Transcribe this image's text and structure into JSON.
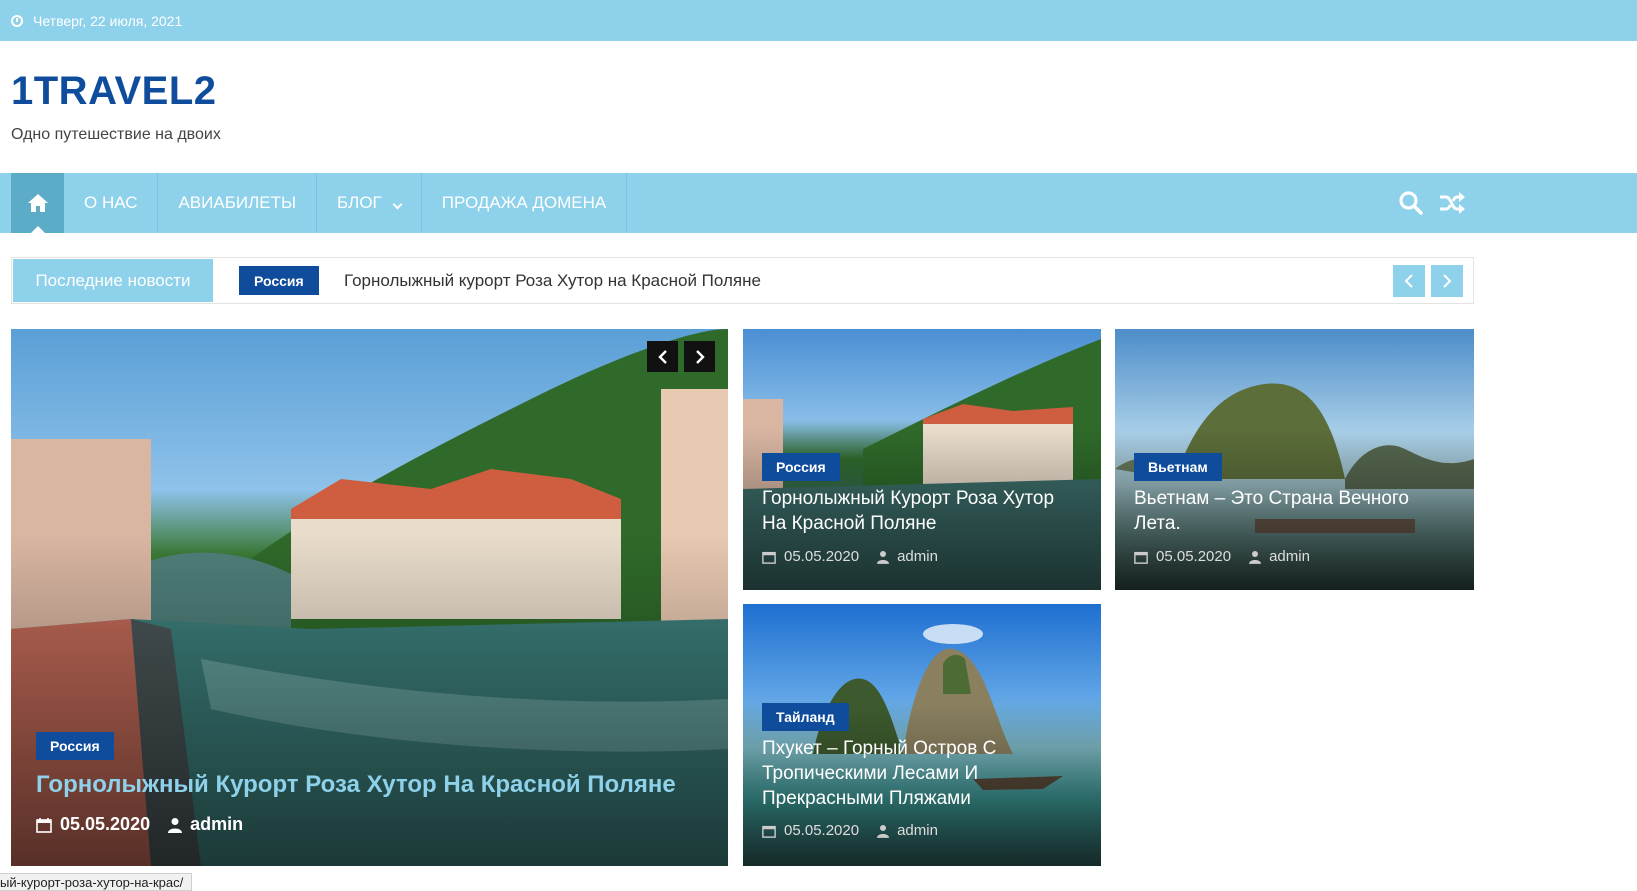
{
  "topbar": {
    "date": "Четверг, 22 июля, 2021",
    "icon": "clock-icon"
  },
  "brand": {
    "title": "1TRAVEL2",
    "tagline": "Одно путешествие на двоих"
  },
  "nav": {
    "home_icon": "home-icon",
    "items": [
      {
        "label": "О НАС"
      },
      {
        "label": "АВИАБИЛЕТЫ"
      },
      {
        "label": "БЛОГ",
        "has_dropdown": true
      },
      {
        "label": "ПРОДАЖА ДОМЕНА"
      }
    ],
    "tools": [
      "search-icon",
      "shuffle-icon"
    ]
  },
  "ticker": {
    "label": "Последние новости",
    "category": "Россия",
    "headline": "Горнолыжный курорт Роза Хутор на Красной Поляне"
  },
  "featured": {
    "category": "Россия",
    "title": "Горнолыжный Курорт Роза Хутор На Красной Поляне",
    "date": "05.05.2020",
    "author": "admin"
  },
  "posts": [
    {
      "category": "Россия",
      "title": "Горнолыжный Курорт Роза Хутор На Красной Поляне",
      "date": "05.05.2020",
      "author": "admin"
    },
    {
      "category": "Вьетнам",
      "title": "Вьетнам – Это Страна Вечного Лета.",
      "date": "05.05.2020",
      "author": "admin"
    },
    {
      "category": "Тайланд",
      "title": "Пхукет – Горный Остров С Тропическими Лесами И Прекрасными Пляжами",
      "date": "05.05.2020",
      "author": "admin"
    }
  ],
  "statusbar": {
    "url": "ый-курорт-роза-хутор-на-крас/"
  },
  "colors": {
    "accent": "#8ed1ea",
    "brand": "#0f4c9c",
    "home_bg": "#5cacc8"
  }
}
